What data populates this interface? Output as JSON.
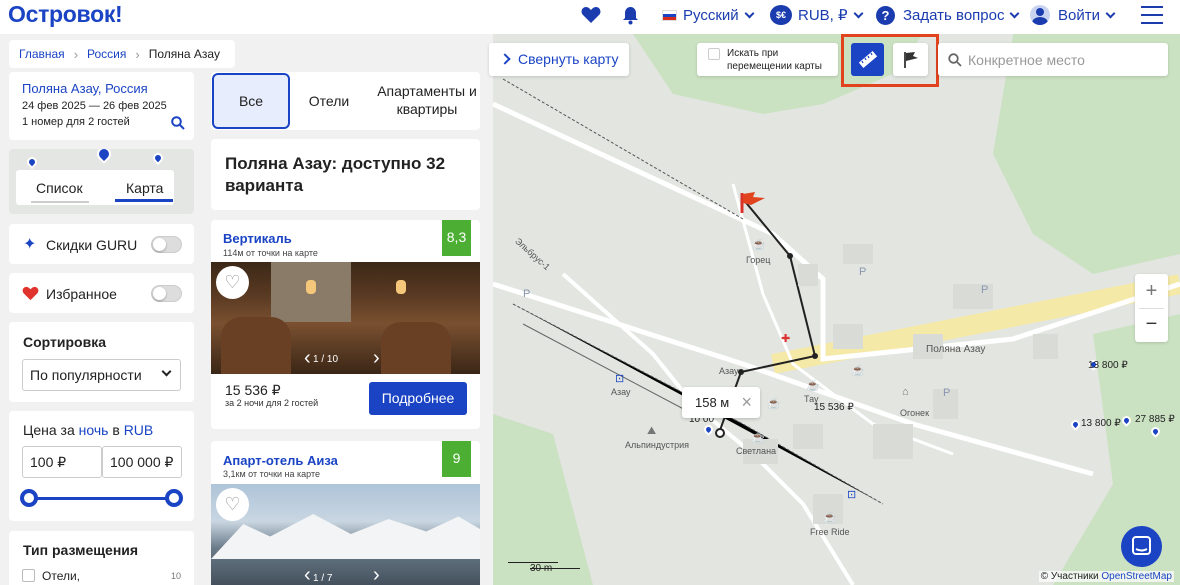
{
  "header": {
    "logo": "Островок!",
    "language": "Русский",
    "currency": "RUB, ₽",
    "ask": "Задать вопрос",
    "login": "Войти"
  },
  "breadcrumb": [
    "Главная",
    "Россия",
    "Поляна Азау"
  ],
  "search": {
    "destination": "Поляна Азау, Россия",
    "dates": "24 фев 2025 — 26 фев 2025",
    "guests": "1 номер для 2 гостей"
  },
  "view_tabs": [
    "Список",
    "Карта"
  ],
  "filters": {
    "guru": "Скидки GURU",
    "favorites": "Избранное",
    "sort_title": "Сортировка",
    "sort_value": "По популярности",
    "price_title_1": "Цена за",
    "price_title_2": "ночь",
    "price_title_3": "в",
    "price_title_4": "RUB",
    "price_min": "100 ₽",
    "price_max": "100 000 ₽",
    "type_title": "Тип размещения",
    "type_item": "Отели,",
    "type_count": "10"
  },
  "category_tabs": [
    "Все",
    "Отели",
    "Апартаменты и квартиры"
  ],
  "results_title": "Поляна Азау: доступно 32 варианта",
  "hotels": [
    {
      "name": "Вертикаль",
      "distance": "114м от точки на карте",
      "rating": "8,3",
      "photo_counter": "1 / 10",
      "price": "15 536 ₽",
      "price_note": "за 2 ночи для 2 гостей",
      "button": "Подробнее"
    },
    {
      "name": "Апарт-отель Аиза",
      "distance": "3,1км от точки на карте",
      "rating": "9",
      "photo_counter": "1 / 7"
    }
  ],
  "map": {
    "collapse": "Свернуть карту",
    "search_on_move": "Искать при перемещении карты",
    "search_placeholder": "Конкретное место",
    "measure": "158 м",
    "scale": "30 m",
    "attribution_prefix": "© Участники",
    "attribution_link": "OpenStreetMap",
    "labels": {
      "gorets": "Горец",
      "azau_street": "Поляна Азау",
      "elbrus": "Эльбрус-1",
      "azau1": "Азау",
      "azau2": "Азау",
      "ogonek": "Огонек",
      "alpindustria": "Альпиндустрия",
      "svetlana": "Светлана",
      "freeride": "Free Ride",
      "tau": "Тау"
    },
    "prices": [
      "15 536 ₽",
      "13 800 ₽",
      "13 800 ₽",
      "27 885 ₽",
      "10 00"
    ]
  },
  "colors": {
    "brand": "#1a44c4",
    "rating": "#4caf33",
    "highlight": "#e0431e"
  }
}
